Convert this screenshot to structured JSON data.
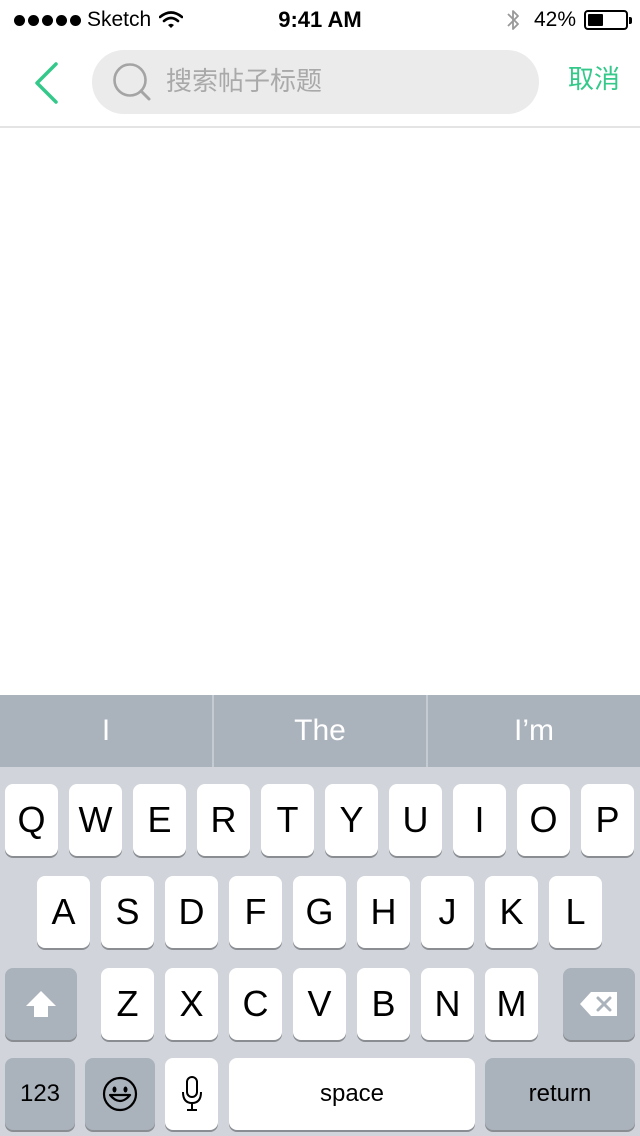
{
  "status_bar": {
    "carrier": "Sketch",
    "time": "9:41 AM",
    "battery_percent": "42%",
    "battery_level": 0.42
  },
  "nav": {
    "back_icon": "chevron-left-icon",
    "search_placeholder": "搜索帖子标题",
    "search_value": "",
    "cancel_label": "取消",
    "accent_color": "#34c88a"
  },
  "keyboard": {
    "suggestions": [
      "I",
      "The",
      "I’m"
    ],
    "row1": [
      "Q",
      "W",
      "E",
      "R",
      "T",
      "Y",
      "U",
      "I",
      "O",
      "P"
    ],
    "row2": [
      "A",
      "S",
      "D",
      "F",
      "G",
      "H",
      "J",
      "K",
      "L"
    ],
    "row3": [
      "Z",
      "X",
      "C",
      "V",
      "B",
      "N",
      "M"
    ],
    "numbers_label": "123",
    "space_label": "space",
    "return_label": "return",
    "icons": {
      "shift": "shift-icon",
      "backspace": "backspace-icon",
      "emoji": "emoji-icon",
      "mic": "microphone-icon"
    }
  }
}
